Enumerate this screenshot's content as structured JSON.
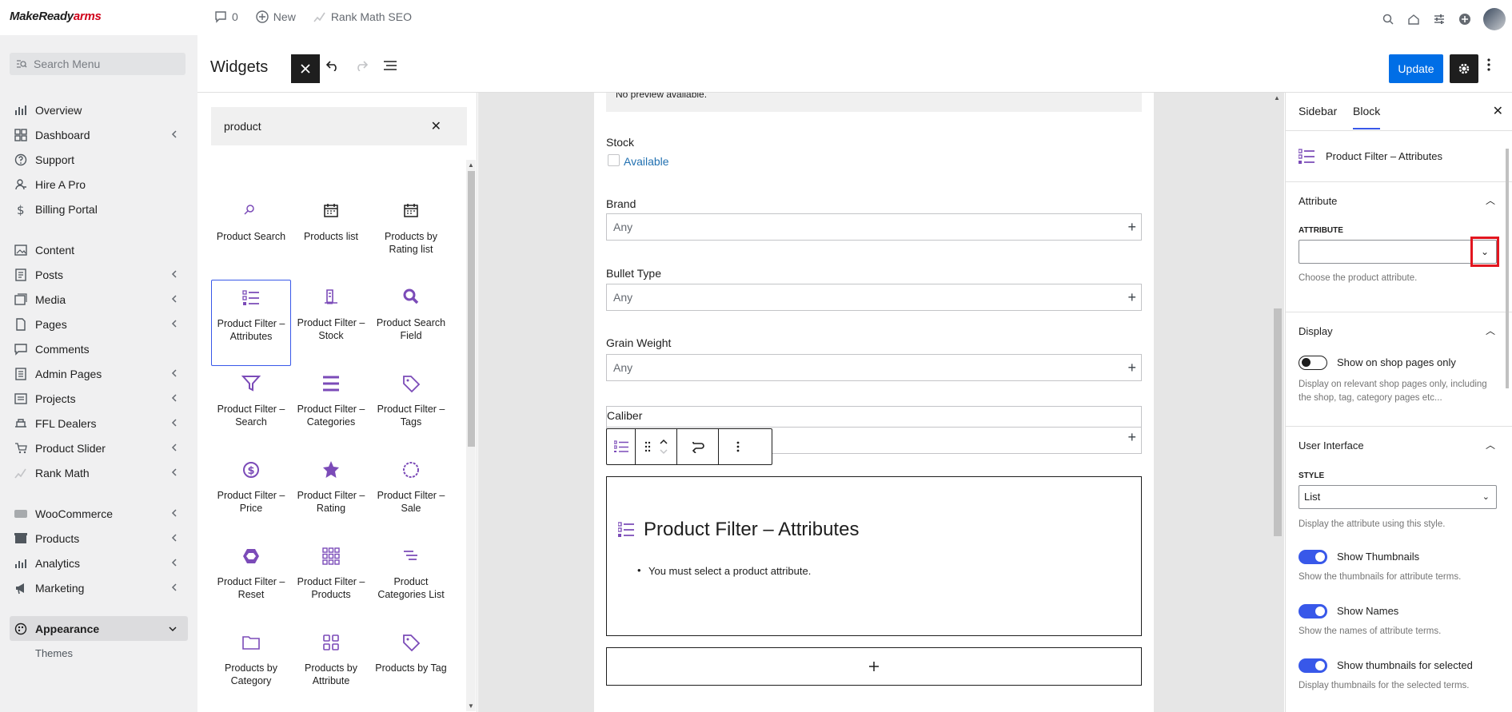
{
  "topbar": {
    "brand_left": "MakeReady",
    "brand_right": "arms",
    "comments_count": "0",
    "new_label": "New",
    "seo_label": "Rank Math SEO"
  },
  "sidebar": {
    "search_placeholder": "Search Menu",
    "group1": [
      {
        "label": "Overview",
        "icon": "chart-icon",
        "chev": false
      },
      {
        "label": "Dashboard",
        "icon": "grid-icon",
        "chev": true
      },
      {
        "label": "Support",
        "icon": "help-icon",
        "chev": false
      },
      {
        "label": "Hire A Pro",
        "icon": "person-icon",
        "chev": false
      },
      {
        "label": "Billing Portal",
        "icon": "dollar-icon",
        "chev": false
      }
    ],
    "group2": [
      {
        "label": "Content",
        "icon": "image-icon",
        "chev": false
      },
      {
        "label": "Posts",
        "icon": "post-icon",
        "chev": true
      },
      {
        "label": "Media",
        "icon": "media-icon",
        "chev": true
      },
      {
        "label": "Pages",
        "icon": "page-icon",
        "chev": true
      },
      {
        "label": "Comments",
        "icon": "comment-icon",
        "chev": false
      },
      {
        "label": "Admin Pages",
        "icon": "admin-pages-icon",
        "chev": true
      },
      {
        "label": "Projects",
        "icon": "projects-icon",
        "chev": true
      },
      {
        "label": "FFL Dealers",
        "icon": "dealer-icon",
        "chev": true
      },
      {
        "label": "Product Slider",
        "icon": "slider-icon",
        "chev": true
      },
      {
        "label": "Rank Math",
        "icon": "rankmath-icon",
        "chev": true
      }
    ],
    "group3": [
      {
        "label": "WooCommerce",
        "icon": "woo-icon",
        "chev": true
      },
      {
        "label": "Products",
        "icon": "box-icon",
        "chev": true
      },
      {
        "label": "Analytics",
        "icon": "analytics-icon",
        "chev": true
      },
      {
        "label": "Marketing",
        "icon": "megaphone-icon",
        "chev": true
      }
    ],
    "appearance": "Appearance",
    "themes": "Themes"
  },
  "editor": {
    "title": "Widgets",
    "update_label": "Update"
  },
  "inserter": {
    "search_value": "product",
    "blocks": [
      {
        "label": "Product Search",
        "icon": "search-icon"
      },
      {
        "label": "Products list",
        "icon": "calendar-icon"
      },
      {
        "label": "Products by Rating list",
        "icon": "calendar-icon"
      },
      {
        "label": "Product Filter – Attributes",
        "icon": "list-icon",
        "selected": true
      },
      {
        "label": "Product Filter – Stock",
        "icon": "stock-icon"
      },
      {
        "label": "Product Search Field",
        "icon": "magnifier-icon"
      },
      {
        "label": "Product Filter – Search",
        "icon": "funnel-icon"
      },
      {
        "label": "Product Filter – Categories",
        "icon": "menu-icon"
      },
      {
        "label": "Product Filter – Tags",
        "icon": "tag-icon"
      },
      {
        "label": "Product Filter – Price",
        "icon": "price-icon"
      },
      {
        "label": "Product Filter – Rating",
        "icon": "star-icon"
      },
      {
        "label": "Product Filter – Sale",
        "icon": "sale-icon"
      },
      {
        "label": "Product Filter – Reset",
        "icon": "hexagon-icon"
      },
      {
        "label": "Product Filter – Products",
        "icon": "grid9-icon"
      },
      {
        "label": "Product Categories List",
        "icon": "categories-icon"
      },
      {
        "label": "Products by Category",
        "icon": "folder-icon"
      },
      {
        "label": "Products by Attribute",
        "icon": "grid4-icon"
      },
      {
        "label": "Products by Tag",
        "icon": "tag-icon"
      }
    ]
  },
  "canvas": {
    "preview_text": "No preview available.",
    "stock_label": "Stock",
    "available_label": "Available",
    "brand_label": "Brand",
    "bullet_label": "Bullet Type",
    "grain_label": "Grain Weight",
    "caliber_label": "Caliber",
    "any_placeholder": "Any",
    "block_title": "Product Filter – Attributes",
    "block_msg": "You must select a product attribute."
  },
  "settings": {
    "tab_sidebar": "Sidebar",
    "tab_block": "Block",
    "block_name": "Product Filter – Attributes",
    "attribute_section": "Attribute",
    "attribute_caption": "ATTRIBUTE",
    "attribute_help": "Choose the product attribute.",
    "display_section": "Display",
    "shop_only_label": "Show on shop pages only",
    "shop_only_help": "Display on relevant shop pages only, including the shop, tag, category pages etc...",
    "ui_section": "User Interface",
    "style_caption": "STYLE",
    "style_value": "List",
    "style_help": "Display the attribute using this style.",
    "thumbs_label": "Show Thumbnails",
    "thumbs_help": "Show the thumbnails for attribute terms.",
    "names_label": "Show Names",
    "names_help": "Show the names of attribute terms.",
    "thumbs_sel_label": "Show thumbnails for selected",
    "thumbs_sel_help": "Display thumbnails for the selected terms."
  },
  "colors": {
    "accent": "#3858e9",
    "update_button": "#006ee6",
    "block_icon": "#7b4bb8",
    "highlight_box": "#e2161f"
  }
}
